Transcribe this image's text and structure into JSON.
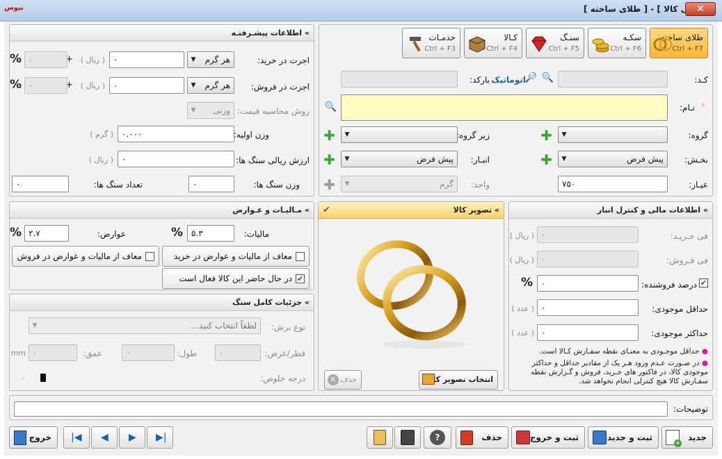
{
  "window": {
    "title": "[ معرفی کالا ] - [ طلای ساخته ]",
    "app_icon": "نیوس",
    "close": "✕"
  },
  "tabs": [
    {
      "label": "طلای ساخته",
      "shortcut": "Ctrl + F7",
      "active": true
    },
    {
      "label": "سکـه",
      "shortcut": "Ctrl + F6",
      "active": false
    },
    {
      "label": "سنـگ",
      "shortcut": "Ctrl + F5",
      "active": false
    },
    {
      "label": "کـالا",
      "shortcut": "Ctrl + F4",
      "active": false
    },
    {
      "label": "خدمـات",
      "shortcut": "Ctrl + F3",
      "active": false
    }
  ],
  "main": {
    "code_label": "کـد:",
    "code_value": "",
    "barcode_label": "بارکد:",
    "auto_label": "اتوماتیک",
    "barcode_value": "",
    "name_label": "نـام:",
    "name_value": "",
    "required_mark": "*",
    "group_label": "گروه:",
    "group_value": "",
    "subgroup_label": "زیر گروه:",
    "subgroup_value": "",
    "section_label": "بخـش:",
    "section_value": "پیش فرض",
    "warehouse_label": "انبـار:",
    "warehouse_value": "پیش فرض",
    "karat_label": "عیـار:",
    "karat_value": "۷۵۰",
    "unit_label": "واحد:",
    "unit_value": "گرم"
  },
  "advanced": {
    "title": "اطلاعات پیشـرفتـه",
    "buy_wage_label": "اجرت در خرید:",
    "buy_wage_mode": "هر گرم",
    "buy_wage_value": "۰",
    "buy_wage_unit": "( ریال )",
    "buy_wage_pct": "۰",
    "sell_wage_label": "اجرت در فروش:",
    "sell_wage_mode": "هر گرم",
    "sell_wage_value": "۰",
    "sell_wage_unit": "( ریال )",
    "sell_wage_pct": "۰",
    "price_method_label": "روش محاسبه قیمت:",
    "price_method_value": "وزنی",
    "initial_weight_label": "وزن اولیه:",
    "initial_weight_value": "۰.۰۰۰",
    "initial_weight_unit": "( گرم )",
    "stone_value_label": "ارزش ریالی سنگ ها:",
    "stone_value_value": "۰",
    "stone_value_unit": "( ریال )",
    "stone_weight_label": "وزن سنگ ها:",
    "stone_weight_value": "۰",
    "stone_count_label": "تعداد سنگ ها:",
    "stone_count_value": "۰"
  },
  "tax": {
    "title": "مـالیـات و عـوارض",
    "tax_label": "مالیات:",
    "tax_value": "۵.۳",
    "duty_label": "عوارض:",
    "duty_value": "۲.۷",
    "exempt_buy": "معاف از مالیات و عوارض در خرید",
    "exempt_buy_checked": false,
    "exempt_sell": "معاف از مالیات و عوارض در فروش",
    "exempt_sell_checked": false,
    "active_label": "در حال حاضر این کالا فعال است",
    "active_checked": true
  },
  "stone": {
    "title": "جزئیات کامل سنگ",
    "cut_label": "نوع برش:",
    "cut_placeholder": "لطفاً انتخاب کنید...",
    "diameter_label": "قطر/عرض:",
    "diameter_value": "۰",
    "length_label": "طول:",
    "length_value": "۰",
    "depth_label": "عمق:",
    "depth_value": "۰",
    "mm": "mm",
    "purity_label": "درجه خلوص:",
    "purity_value": "۰"
  },
  "image": {
    "title": "تصویر کالا",
    "select_btn": "انتخاب تصویر کالا",
    "delete_btn": "حذف"
  },
  "finance": {
    "title": "اطلاعات مالی و کنترل انبار",
    "buy_price_label": "فی خـریـد:",
    "buy_price_value": "۰",
    "buy_price_unit": "( ریال )",
    "sell_price_label": "فی فـروش:",
    "sell_price_value": "۰",
    "sell_price_unit": "( ریال )",
    "seller_pct_label": "درصد فروشنده:",
    "seller_pct_value": "۰",
    "seller_pct_checked": true,
    "min_stock_label": "حداقل موجودی:",
    "min_stock_value": "۰",
    "min_stock_unit": "( عدد )",
    "max_stock_label": "حداکثر موجودی:",
    "max_stock_value": "۰",
    "max_stock_unit": "( عدد )",
    "note1": "حداقل موجـودی به معنـای نقطه سفـارش کـالا است.",
    "note2": "در صـورت عـدم ورود هـر یک از مقادیر حداقل و حداکثر موجودی کالا، در فاکتور های خـرید، فروش و گـزارش نقطه سفـارش کالا هیچ کنترلی انجام نخواهد شد."
  },
  "description": {
    "label": "توضیحات:",
    "value": ""
  },
  "footer": {
    "new": "جدید",
    "save_new": "ثبت و جدید",
    "save_exit": "ثبت و خروج",
    "delete": "حذف",
    "exit": "خروج"
  },
  "colors": {
    "accent": "#f6b73a",
    "titlebar": "#b4cce8",
    "name_bg": "#fffbc2",
    "plus": "#3aa636"
  }
}
